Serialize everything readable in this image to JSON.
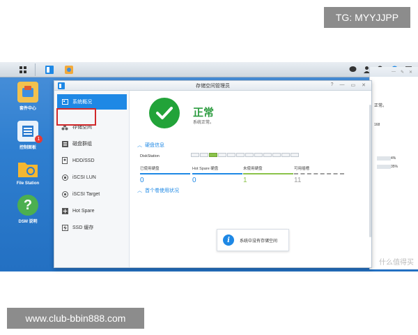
{
  "badges": {
    "tg": "TG: MYYJJPP",
    "url": "www.club-bbin888.com"
  },
  "watermark": "什么值得买",
  "desktop": {
    "icons": [
      {
        "label": "套件中心",
        "icon": "package-center-icon"
      },
      {
        "label": "控制面板",
        "icon": "control-panel-icon",
        "badge": "1"
      },
      {
        "label": "File Station",
        "icon": "folder-icon"
      },
      {
        "label": "DSM 说明",
        "icon": "help-icon"
      }
    ]
  },
  "window": {
    "title": "存储空间管理员",
    "controls": [
      "?",
      "—",
      "▭",
      "✕"
    ],
    "sidebar": [
      {
        "label": "系统概况",
        "icon": "overview-icon"
      },
      {
        "label": "存储空间",
        "icon": "storage-pool-icon"
      },
      {
        "label": "磁盘群组",
        "icon": "disk-group-icon"
      },
      {
        "label": "HDD/SSD",
        "icon": "hdd-icon"
      },
      {
        "label": "iSCSI LUN",
        "icon": "iscsi-lun-icon"
      },
      {
        "label": "iSCSI Target",
        "icon": "iscsi-target-icon"
      },
      {
        "label": "Hot Spare",
        "icon": "hot-spare-icon"
      },
      {
        "label": "SSD 缓存",
        "icon": "ssd-cache-icon"
      }
    ],
    "status": {
      "title": "正常",
      "subtitle": "系统正常。"
    },
    "disk_section": {
      "heading": "硬盘信息",
      "device": "DiskStation",
      "stats": [
        {
          "label": "已使用硬盘",
          "value": "0",
          "color": "#1e88e5"
        },
        {
          "label": "Hot Spare 硬盘",
          "value": "0",
          "color": "#1e88e5"
        },
        {
          "label": "未使用硬盘",
          "value": "1",
          "color": "#8bc34a"
        },
        {
          "label": "可用插槽",
          "value": "11",
          "color": "#9e9e9e"
        }
      ]
    },
    "volume_section": {
      "heading": "首个卷使用状况"
    },
    "empty_message": "系统中没有存储空间"
  },
  "bg_window": {
    "lines": [
      "正常。",
      "168",
      "4%",
      "35%"
    ]
  }
}
